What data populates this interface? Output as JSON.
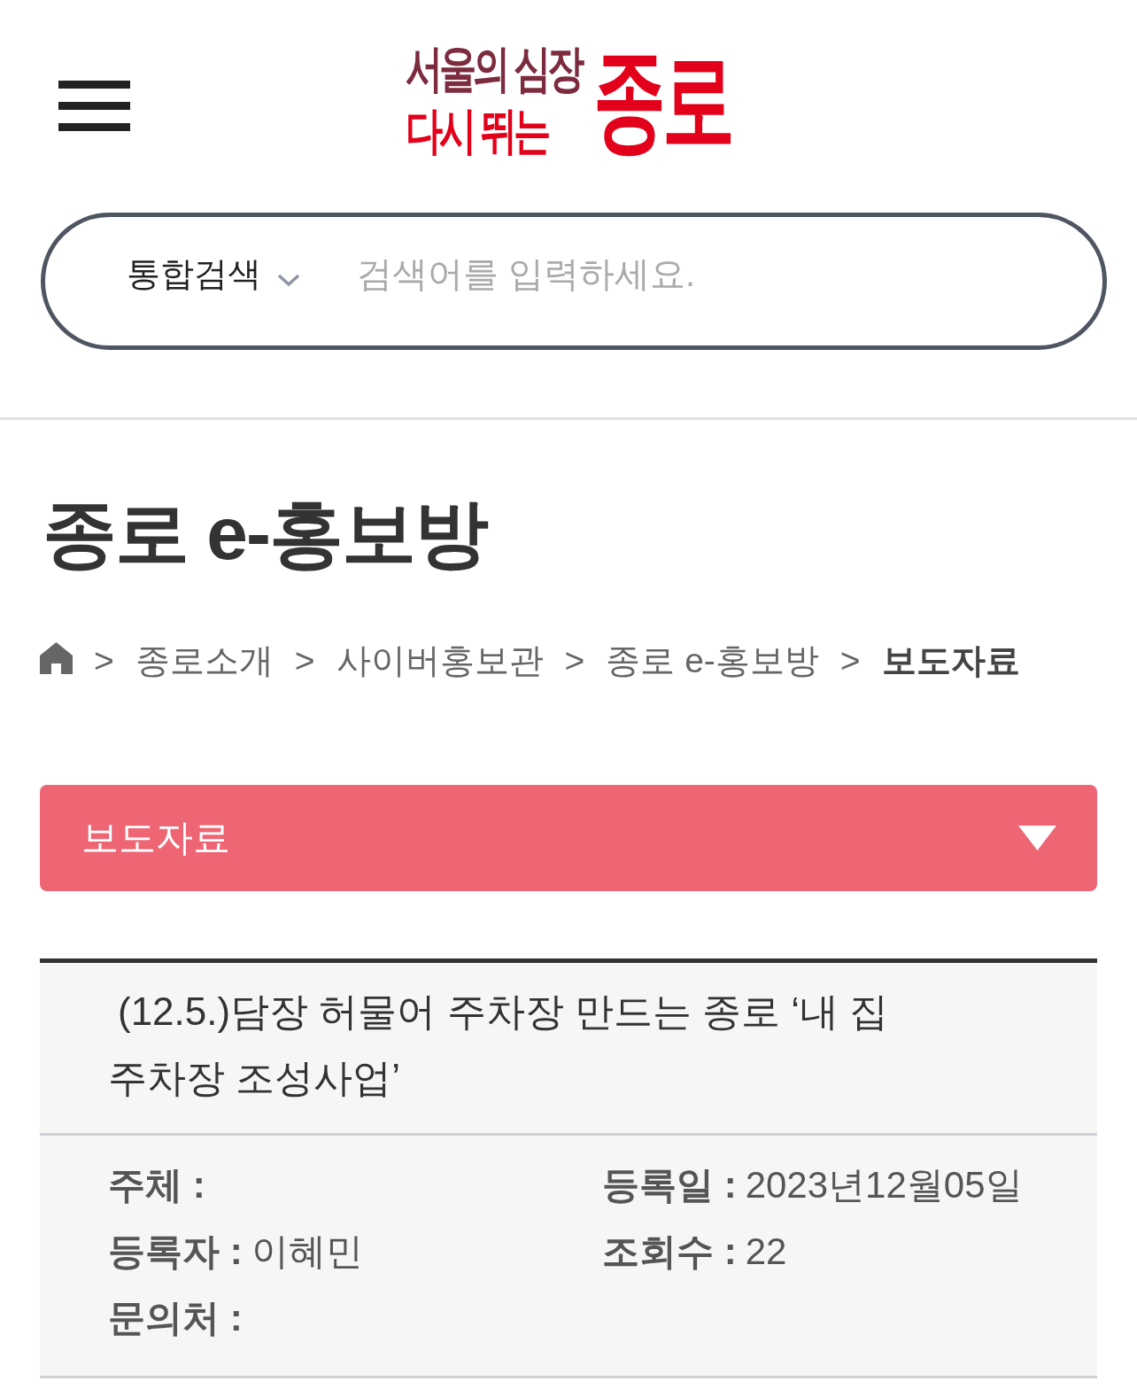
{
  "header": {
    "logo": {
      "tagline_top": "서울의 심장",
      "tagline_bottom": "다시 뛰는",
      "wordmark": "종로"
    }
  },
  "search": {
    "scope": "통합검색",
    "placeholder": "검색어를 입력하세요."
  },
  "page_title": "종로 e-홍보방",
  "breadcrumb": [
    {
      "separator": ">",
      "label": "종로소개",
      "selected": false
    },
    {
      "separator": ">",
      "label": "사이버홍보관",
      "selected": false
    },
    {
      "separator": ">",
      "label": "종로 e-홍보방",
      "selected": false
    },
    {
      "separator": ">",
      "label": "보도자료",
      "selected": true
    }
  ],
  "category_select": {
    "value": "보도자료"
  },
  "article": {
    "title": "(12.5.)담장 허물어 주차장 만드는 종로 ‘내 집 주차장 조성사업’",
    "meta": [
      {
        "label": "주체 :"
      },
      {
        "label": "등록일 :",
        "value": "2023년12월05일"
      },
      {
        "label": "등록자 :",
        "value": "이혜민"
      },
      {
        "label": "조회수 :",
        "value": "22"
      },
      {
        "label": "문의처 :"
      }
    ]
  }
}
